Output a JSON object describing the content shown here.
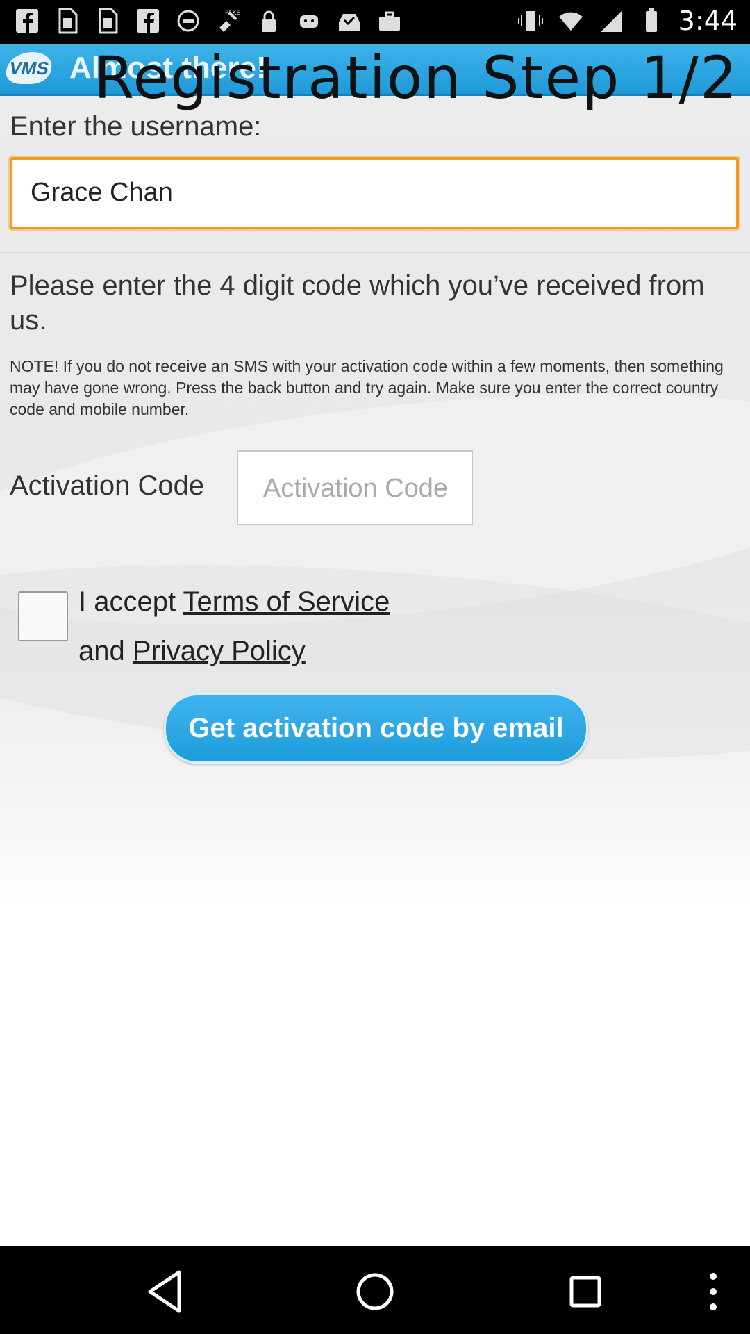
{
  "status_bar": {
    "time": "3:44",
    "icons": [
      "facebook-icon",
      "sim-card-icon",
      "sim-card-icon",
      "facebook-icon",
      "sync-icon",
      "fake-gps-icon",
      "lock-icon",
      "android-icon",
      "inbox-check-icon",
      "briefcase-icon",
      "vibrate-icon",
      "wifi-icon",
      "signal-icon",
      "battery-icon"
    ]
  },
  "header": {
    "logo_text": "VMS",
    "title": "Almost there!",
    "overlay_title": "Registration Step 1/2",
    "accent_color": "#1f9ad8"
  },
  "username": {
    "label": "Enter the username:",
    "value": "Grace Chan",
    "focus_color": "#f29a25"
  },
  "instructions": {
    "main": "Please enter the 4 digit code which you’ve received from us.",
    "note": "NOTE! If you do not receive an SMS with your activation code within a few moments, then something may have gone wrong. Press the back button and try again. Make sure you enter the correct country code and mobile number."
  },
  "activation": {
    "label": "Activation Code",
    "placeholder": "Activation Code"
  },
  "terms": {
    "checked": false,
    "prefix": "I accept ",
    "terms_link": "Terms of Service",
    "middle": "and ",
    "privacy_link": "Privacy Policy"
  },
  "email_button": {
    "label": "Get activation code by email"
  },
  "nav_bar": {
    "buttons": [
      "back-icon",
      "home-icon",
      "recents-icon",
      "overflow-menu-icon"
    ]
  }
}
